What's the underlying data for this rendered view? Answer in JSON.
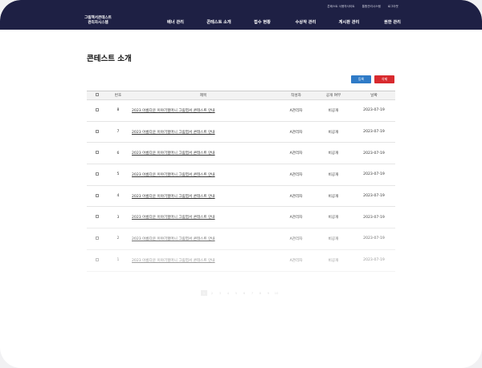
{
  "header": {
    "logo_line1": "그림책서콘테스트",
    "logo_line2": "관리자시스템",
    "util_links": [
      "콘테스트 사용자사이트",
      "통합관리시스템",
      "로그아웃"
    ],
    "nav": [
      "배너 관리",
      "콘테스트 소개",
      "접수 현황",
      "수상작 관리",
      "게시판 관리",
      "권한 관리"
    ]
  },
  "page": {
    "title": "콘테스트 소개"
  },
  "buttons": {
    "add": "등록",
    "delete": "삭제"
  },
  "table": {
    "headers": {
      "number": "번호",
      "title": "제목",
      "writer": "작성자",
      "public": "공개 여부",
      "date": "날짜"
    },
    "rows": [
      {
        "number": "8",
        "title": "2023 아름다운 이야기할머니 그림엽서 콘테스트 안내",
        "writer": "A관리자",
        "public": "비공개",
        "date": "2023-07-19"
      },
      {
        "number": "7",
        "title": "2023 아름다운 이야기할머니 그림엽서 콘테스트 안내",
        "writer": "A관리자",
        "public": "비공개",
        "date": "2023-07-19"
      },
      {
        "number": "6",
        "title": "2023 아름다운 이야기할머니 그림엽서 콘테스트 안내",
        "writer": "A관리자",
        "public": "비공개",
        "date": "2023-07-19"
      },
      {
        "number": "5",
        "title": "2023 아름다운 이야기할머니 그림엽서 콘테스트 안내",
        "writer": "A관리자",
        "public": "비공개",
        "date": "2023-07-19"
      },
      {
        "number": "4",
        "title": "2023 아름다운 이야기할머니 그림엽서 콘테스트 안내",
        "writer": "A관리자",
        "public": "비공개",
        "date": "2023-07-19"
      },
      {
        "number": "3",
        "title": "2023 아름다운 이야기할머니 그림엽서 콘테스트 안내",
        "writer": "A관리자",
        "public": "비공개",
        "date": "2023-07-19"
      },
      {
        "number": "2",
        "title": "2023 아름다운 이야기할머니 그림엽서 콘테스트 안내",
        "writer": "A관리자",
        "public": "비공개",
        "date": "2023-07-19"
      },
      {
        "number": "1",
        "title": "2023 아름다운 이야기할머니 그림엽서 콘테스트 안내",
        "writer": "A관리자",
        "public": "비공개",
        "date": "2023-07-19"
      }
    ]
  },
  "pagination": {
    "pages": [
      "1",
      "2",
      "3",
      "4",
      "5",
      "6",
      "7",
      "8",
      "9",
      "10"
    ],
    "current": "1"
  },
  "colors": {
    "header_bg": "#1e2044",
    "add_button": "#2f7bc7",
    "delete_button": "#d82a2e"
  }
}
